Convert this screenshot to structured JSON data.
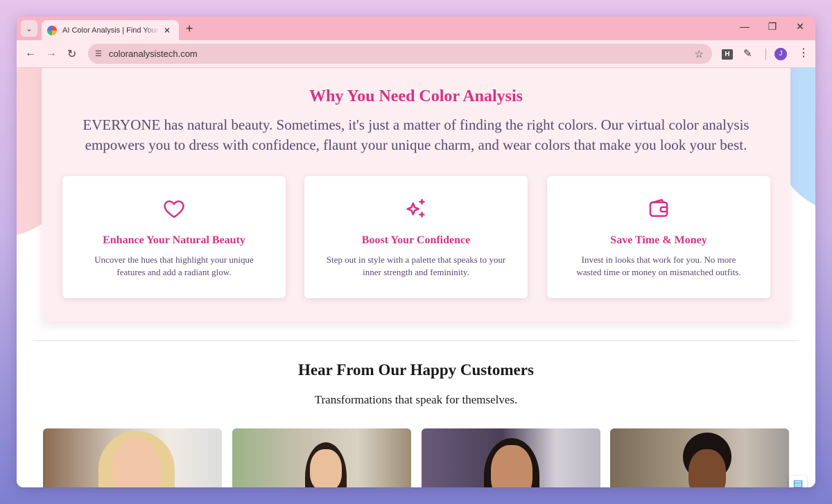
{
  "browser": {
    "tab_title": "AI Color Analysis | Find Your Co",
    "url": "coloranalysistech.com",
    "profile_initial": "J",
    "extension_label": "H"
  },
  "why_section": {
    "title": "Why You Need Color Analysis",
    "text": "EVERYONE has natural beauty. Sometimes, it's just a matter of finding the right colors. Our virtual color analysis empowers you to dress with confidence, flaunt your unique charm, and wear colors that make you look your best.",
    "cards": [
      {
        "icon": "heart-icon",
        "title": "Enhance Your Natural Beauty",
        "desc": "Uncover the hues that highlight your unique features and add a radiant glow."
      },
      {
        "icon": "sparkles-icon",
        "title": "Boost Your Confidence",
        "desc": "Step out in style with a palette that speaks to your inner strength and femininity."
      },
      {
        "icon": "wallet-icon",
        "title": "Save Time & Money",
        "desc": "Invest in looks that work for you. No more wasted time or money on mismatched outfits."
      }
    ]
  },
  "customers_section": {
    "title": "Hear From Our Happy Customers",
    "subtitle": "Transformations that speak for themselves."
  },
  "colors": {
    "accent": "#d63384",
    "body_text": "#5a4a6e",
    "panel_bg": "#fdeef2"
  }
}
